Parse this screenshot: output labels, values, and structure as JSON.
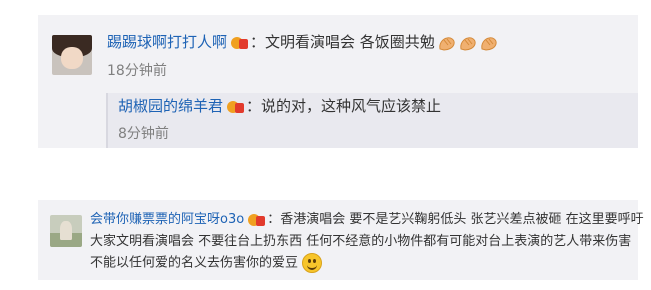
{
  "comment1": {
    "username": "踢踢球啊打打人啊",
    "text": "：文明看演唱会 各饭圈共勉",
    "time": "18分钟前",
    "badge_icon": "vip-badge-icon",
    "emoji_icon": "clap-icon"
  },
  "reply1": {
    "username": "胡椒园的绵羊君",
    "text": "：说的对，这种风气应该禁止",
    "time": "8分钟前",
    "badge_icon": "vip-badge-icon"
  },
  "comment2": {
    "username": "会带你赚票票的阿宝呀o3o",
    "line1": "：香港演唱会 要不是艺兴鞠躬低头 张艺兴差点被砸 在这里要呼吁",
    "line2": "大家文明看演唱会 不要往台上扔东西 任何不经意的小物件都有可能对台上表演的艺人带来伤害",
    "line3": "不能以任何爱的名义去伤害你的爱豆",
    "badge_icon": "vip-badge-icon",
    "emoji_icon": "smile-icon"
  }
}
